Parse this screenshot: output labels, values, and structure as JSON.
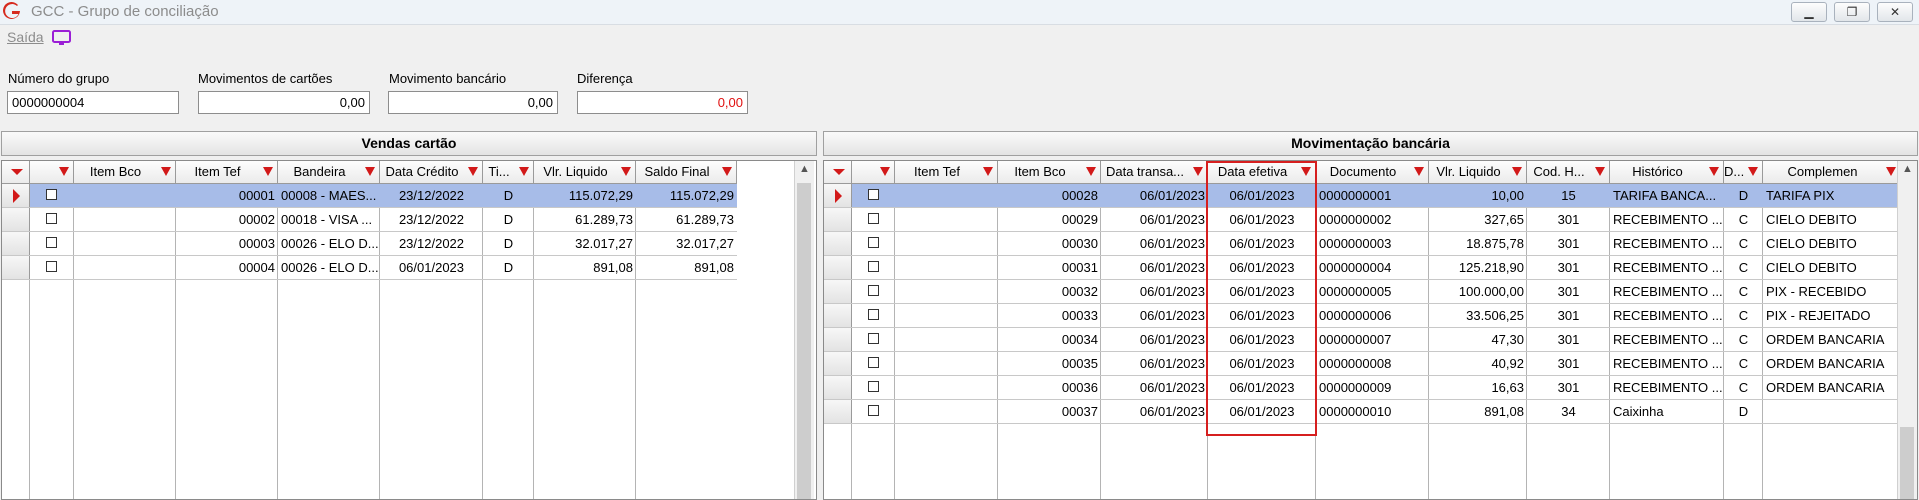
{
  "window": {
    "title": "GCC - Grupo de conciliação",
    "controls": [
      "minimize-icon",
      "restore-icon",
      "close-icon"
    ],
    "logo_color": "#d62a1e"
  },
  "menu": {
    "saida_label": "Saída",
    "monitor_icon_color": "#9b1fd6"
  },
  "fields": {
    "numero_grupo": {
      "label": "Número do grupo",
      "value": "0000000004"
    },
    "movimentos_cartoes": {
      "label": "Movimentos de cartões",
      "value": "0,00"
    },
    "movimento_bancario": {
      "label": "Movimento bancário",
      "value": "0,00"
    },
    "diferenca": {
      "label": "Diferença",
      "value": "0,00",
      "value_color": "#e01010"
    }
  },
  "vendas": {
    "title": "Vendas cartão",
    "columns": [
      "",
      "",
      "Item Bco",
      "Item Tef",
      "Bandeira",
      "Data Crédito",
      "Ti...",
      "Vlr. Liquido",
      "Saldo Final"
    ],
    "rows": [
      {
        "item_bco": "",
        "item_tef": "00001",
        "bandeira": "00008 - MAES...",
        "data_credito": "23/12/2022",
        "tipo": "D",
        "vlr_liquido": "115.072,29",
        "saldo_final": "115.072,29",
        "selected": true
      },
      {
        "item_bco": "",
        "item_tef": "00002",
        "bandeira": "00018 - VISA ...",
        "data_credito": "23/12/2022",
        "tipo": "D",
        "vlr_liquido": "61.289,73",
        "saldo_final": "61.289,73",
        "selected": false
      },
      {
        "item_bco": "",
        "item_tef": "00003",
        "bandeira": "00026 - ELO D...",
        "data_credito": "23/12/2022",
        "tipo": "D",
        "vlr_liquido": "32.017,27",
        "saldo_final": "32.017,27",
        "selected": false
      },
      {
        "item_bco": "",
        "item_tef": "00004",
        "bandeira": "00026 - ELO D...",
        "data_credito": "06/01/2023",
        "tipo": "D",
        "vlr_liquido": "891,08",
        "saldo_final": "891,08",
        "selected": false
      }
    ]
  },
  "movimentacao": {
    "title": "Movimentação bancária",
    "columns": [
      "",
      "",
      "Item Tef",
      "Item Bco",
      "Data transa...",
      "Data efetiva",
      "Documento",
      "Vlr. Liquido",
      "Cod. H...",
      "Histórico",
      "D...",
      "Complemen"
    ],
    "rows": [
      {
        "item_tef": "",
        "item_bco": "00028",
        "data_transacao": "06/01/2023",
        "data_efetiva": "06/01/2023",
        "documento": "0000000001",
        "vlr_liquido": "10,00",
        "cod_h": "15",
        "historico": "TARIFA BANCA...",
        "dc": "D",
        "complemento": "TARIFA PIX",
        "selected": true
      },
      {
        "item_tef": "",
        "item_bco": "00029",
        "data_transacao": "06/01/2023",
        "data_efetiva": "06/01/2023",
        "documento": "0000000002",
        "vlr_liquido": "327,65",
        "cod_h": "301",
        "historico": "RECEBIMENTO ...",
        "dc": "C",
        "complemento": "CIELO DEBITO",
        "selected": false
      },
      {
        "item_tef": "",
        "item_bco": "00030",
        "data_transacao": "06/01/2023",
        "data_efetiva": "06/01/2023",
        "documento": "0000000003",
        "vlr_liquido": "18.875,78",
        "cod_h": "301",
        "historico": "RECEBIMENTO ...",
        "dc": "C",
        "complemento": "CIELO DEBITO",
        "selected": false
      },
      {
        "item_tef": "",
        "item_bco": "00031",
        "data_transacao": "06/01/2023",
        "data_efetiva": "06/01/2023",
        "documento": "0000000004",
        "vlr_liquido": "125.218,90",
        "cod_h": "301",
        "historico": "RECEBIMENTO ...",
        "dc": "C",
        "complemento": "CIELO DEBITO",
        "selected": false
      },
      {
        "item_tef": "",
        "item_bco": "00032",
        "data_transacao": "06/01/2023",
        "data_efetiva": "06/01/2023",
        "documento": "0000000005",
        "vlr_liquido": "100.000,00",
        "cod_h": "301",
        "historico": "RECEBIMENTO ...",
        "dc": "C",
        "complemento": "PIX - RECEBIDO",
        "selected": false
      },
      {
        "item_tef": "",
        "item_bco": "00033",
        "data_transacao": "06/01/2023",
        "data_efetiva": "06/01/2023",
        "documento": "0000000006",
        "vlr_liquido": "33.506,25",
        "cod_h": "301",
        "historico": "RECEBIMENTO ...",
        "dc": "C",
        "complemento": "PIX - REJEITADO",
        "selected": false
      },
      {
        "item_tef": "",
        "item_bco": "00034",
        "data_transacao": "06/01/2023",
        "data_efetiva": "06/01/2023",
        "documento": "0000000007",
        "vlr_liquido": "47,30",
        "cod_h": "301",
        "historico": "RECEBIMENTO ...",
        "dc": "C",
        "complemento": "ORDEM BANCARIA",
        "selected": false
      },
      {
        "item_tef": "",
        "item_bco": "00035",
        "data_transacao": "06/01/2023",
        "data_efetiva": "06/01/2023",
        "documento": "0000000008",
        "vlr_liquido": "40,92",
        "cod_h": "301",
        "historico": "RECEBIMENTO ...",
        "dc": "C",
        "complemento": "ORDEM BANCARIA",
        "selected": false
      },
      {
        "item_tef": "",
        "item_bco": "00036",
        "data_transacao": "06/01/2023",
        "data_efetiva": "06/01/2023",
        "documento": "0000000009",
        "vlr_liquido": "16,63",
        "cod_h": "301",
        "historico": "RECEBIMENTO ...",
        "dc": "C",
        "complemento": "ORDEM BANCARIA",
        "selected": false
      },
      {
        "item_tef": "",
        "item_bco": "00037",
        "data_transacao": "06/01/2023",
        "data_efetiva": "06/01/2023",
        "documento": "0000000010",
        "vlr_liquido": "891,08",
        "cod_h": "34",
        "historico": "Caixinha",
        "dc": "D",
        "complemento": "",
        "selected": false
      }
    ]
  },
  "colors": {
    "selection": "#a7bce8",
    "filter_icon": "#d21919",
    "highlight_border": "#d61f1f"
  }
}
